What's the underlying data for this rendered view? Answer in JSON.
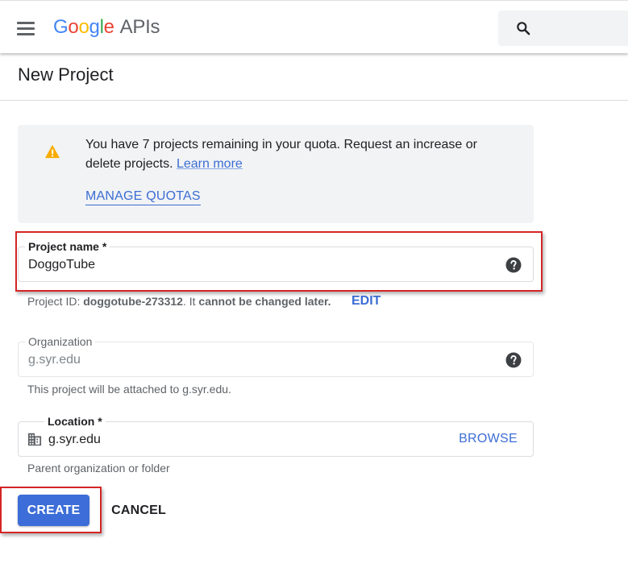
{
  "header": {
    "logo": {
      "g": "G",
      "o1": "o",
      "o2": "o",
      "g2": "g",
      "l": "l",
      "e": "e",
      "suffix": "APIs"
    },
    "menu_icon": "hamburger-menu-icon",
    "search_icon": "search-icon"
  },
  "page": {
    "title": "New Project"
  },
  "notice": {
    "icon": "warning-icon",
    "text": "You have 7 projects remaining in your quota. Request an increase or delete projects.",
    "learn_more": "Learn more",
    "manage_quotas": "MANAGE QUOTAS"
  },
  "project_name": {
    "label": "Project name *",
    "value": "DoggoTube",
    "help_icon": "help-icon"
  },
  "project_id": {
    "prefix": "Project ID: ",
    "id": "doggotube-273312",
    "middle": ". It ",
    "emphasis": "cannot be changed later.",
    "edit_label": "EDIT"
  },
  "organization": {
    "label": "Organization",
    "value": "g.syr.edu",
    "hint": "This project will be attached to g.syr.edu.",
    "help_icon": "help-icon"
  },
  "location": {
    "label": "Location *",
    "value": "g.syr.edu",
    "icon": "building-icon",
    "browse_label": "BROWSE",
    "hint": "Parent organization or folder"
  },
  "actions": {
    "create_label": "CREATE",
    "cancel_label": "CANCEL"
  },
  "colors": {
    "accent_blue": "#3c6dd8",
    "link_blue": "#3c6dd4",
    "warning_yellow": "#f9ab00",
    "annotation_red": "#d42525",
    "notice_bg": "#f1f3f4"
  }
}
